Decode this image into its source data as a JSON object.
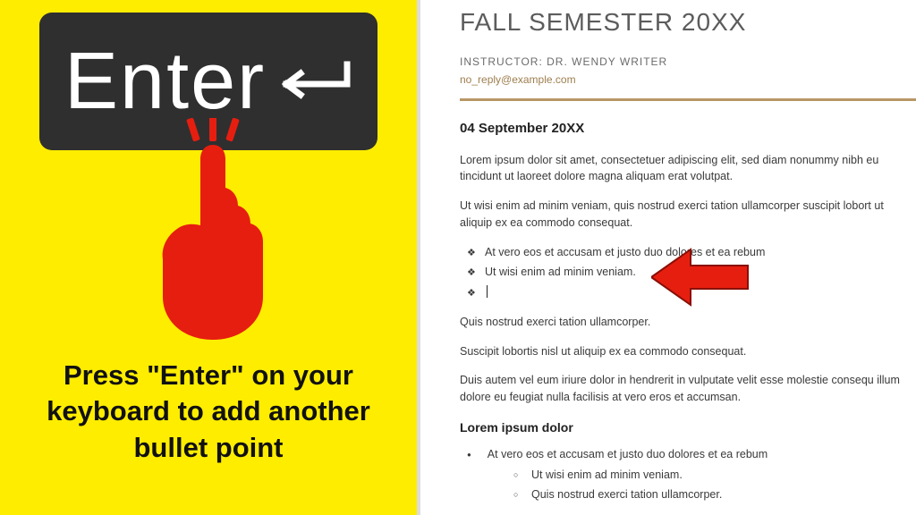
{
  "left": {
    "key_label": "Enter",
    "instruction": "Press \"Enter\" on your keyboard to add another bullet point"
  },
  "doc": {
    "title": "FALL SEMESTER 20XX",
    "instructor": "INSTRUCTOR: DR. WENDY WRITER",
    "email": "no_reply@example.com",
    "date": "04 September 20XX",
    "p1": "Lorem ipsum dolor sit amet, consectetuer adipiscing elit, sed diam nonummy nibh eu tincidunt ut laoreet dolore magna aliquam erat volutpat.",
    "p2": "Ut wisi enim ad minim veniam, quis nostrud exerci tation ullamcorper suscipit lobort ut aliquip ex ea commodo consequat.",
    "diamond": {
      "i0": "At vero eos et accusam et justo duo dolores et ea rebum",
      "i1": "Ut wisi enim ad minim veniam."
    },
    "p3": "Quis nostrud exerci tation ullamcorper.",
    "p4": "Suscipit lobortis nisl ut aliquip ex ea commodo consequat.",
    "p5": "Duis autem vel eum iriure dolor in hendrerit in vulputate velit esse molestie consequ illum dolore eu feugiat nulla facilisis at vero eros et accumsan.",
    "h2": "Lorem ipsum dolor",
    "bullets": {
      "b0": "At vero eos et accusam et justo duo dolores et ea rebum",
      "c0": "Ut wisi enim ad minim veniam.",
      "c1": "Quis nostrud exerci tation ullamcorper."
    }
  }
}
